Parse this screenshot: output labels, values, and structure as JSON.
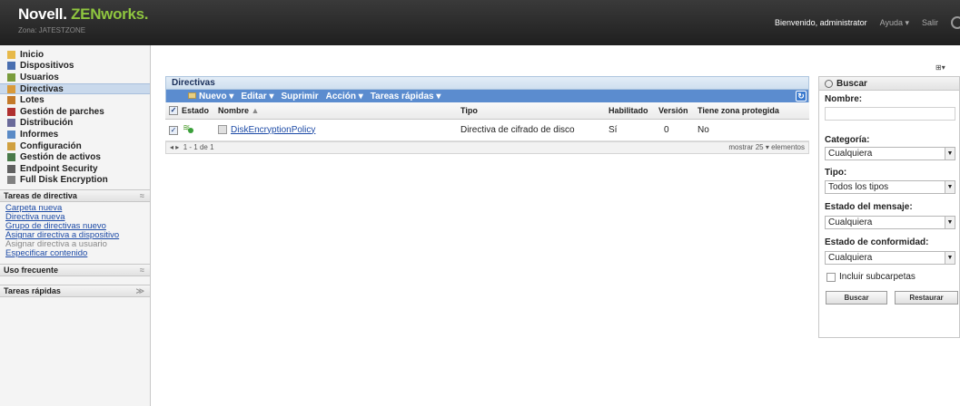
{
  "header": {
    "logo_brand": "Novell.",
    "logo_product": "ZENworks.",
    "zone": "Zona: JATESTZONE",
    "welcome": "Bienvenido, administrator",
    "help": "Ayuda ▾",
    "logout": "Salir"
  },
  "nav": {
    "items": [
      {
        "label": "Inicio",
        "icon": "home-icon",
        "color": "#e7b94a"
      },
      {
        "label": "Dispositivos",
        "icon": "devices-icon",
        "color": "#4a6fb0"
      },
      {
        "label": "Usuarios",
        "icon": "users-icon",
        "color": "#7a9c3c"
      },
      {
        "label": "Directivas",
        "icon": "policies-icon",
        "color": "#d99a3a",
        "active": true
      },
      {
        "label": "Lotes",
        "icon": "bundles-icon",
        "color": "#c47a2a"
      },
      {
        "label": "Gestión de parches",
        "icon": "patch-icon",
        "color": "#b03030"
      },
      {
        "label": "Distribución",
        "icon": "distribution-icon",
        "color": "#6a6a9a"
      },
      {
        "label": "Informes",
        "icon": "reports-icon",
        "color": "#5a8ac6"
      },
      {
        "label": "Configuración",
        "icon": "config-icon",
        "color": "#d0a040"
      },
      {
        "label": "Gestión de activos",
        "icon": "assets-icon",
        "color": "#4a7a4a"
      },
      {
        "label": "Endpoint Security",
        "icon": "endpoint-icon",
        "color": "#606060"
      },
      {
        "label": "Full Disk Encryption",
        "icon": "encryption-icon",
        "color": "#808080"
      }
    ]
  },
  "tasks": {
    "title": "Tareas de directiva",
    "items": [
      {
        "label": "Carpeta nueva",
        "disabled": false
      },
      {
        "label": "Directiva nueva",
        "disabled": false
      },
      {
        "label": "Grupo de directivas nuevo",
        "disabled": false
      },
      {
        "label": "Asignar directiva a dispositivo",
        "disabled": false
      },
      {
        "label": "Asignar directiva a usuario",
        "disabled": true
      },
      {
        "label": "Especificar contenido",
        "disabled": false
      }
    ]
  },
  "frequent": {
    "title": "Uso frecuente"
  },
  "quick": {
    "title": "Tareas rápidas"
  },
  "main": {
    "title": "Directivas",
    "toolbar": [
      "Nuevo ▾",
      "Editar ▾",
      "Suprimir",
      "Acción ▾",
      "Tareas rápidas ▾"
    ],
    "columns": {
      "estado": "Estado",
      "nombre": "Nombre",
      "sort": "▲",
      "tipo": "Tipo",
      "habilitado": "Habilitado",
      "version": "Versión",
      "zona": "Tiene zona protegida"
    },
    "rows": [
      {
        "nombre": "DiskEncryptionPolicy",
        "tipo": "Directiva de cifrado de disco",
        "habilitado": "Sí",
        "version": "0",
        "zona": "No"
      }
    ],
    "pager": {
      "nav": "◂ ▸",
      "range": "1 - 1 de 1",
      "show": "mostrar",
      "count": "25 ▾",
      "items": "elementos"
    }
  },
  "search": {
    "title": "Buscar",
    "name_label": "Nombre:",
    "category_label": "Categoría:",
    "category_value": "Cualquiera",
    "type_label": "Tipo:",
    "type_value": "Todos los tipos",
    "msg_label": "Estado del mensaje:",
    "msg_value": "Cualquiera",
    "comp_label": "Estado de conformidad:",
    "comp_value": "Cualquiera",
    "subfolders": "Incluir subcarpetas",
    "search_btn": "Buscar",
    "reset_btn": "Restaurar"
  },
  "colors": {
    "header": "#252525",
    "toolbar": "#5b8ccf",
    "brand_green": "#8fc63f",
    "link": "#1c4aa6"
  }
}
